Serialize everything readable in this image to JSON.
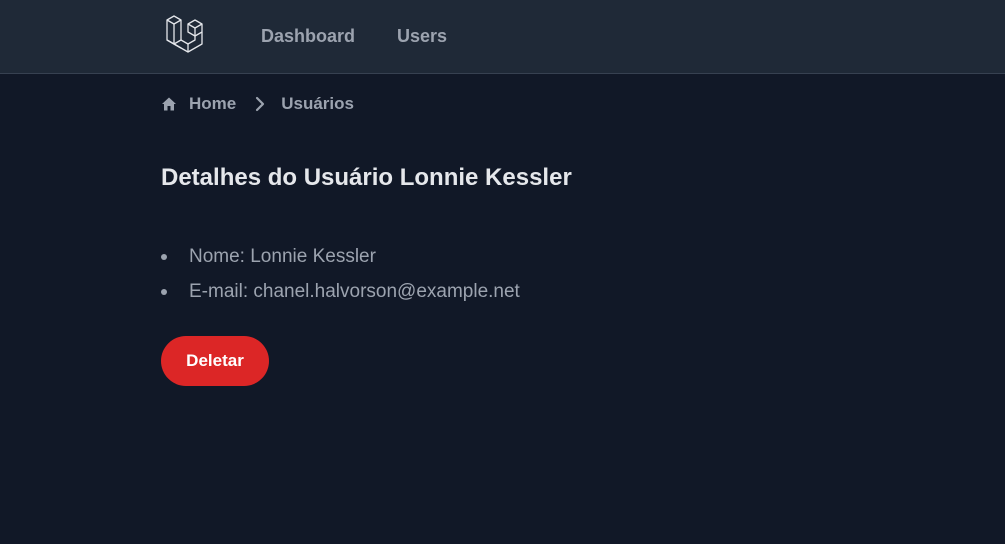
{
  "navbar": {
    "logo_icon": "laravel-logo-icon",
    "links": [
      {
        "label": "Dashboard"
      },
      {
        "label": "Users"
      }
    ]
  },
  "breadcrumb": {
    "home_icon": "home-icon",
    "items": [
      {
        "label": "Home"
      },
      {
        "label": "Usuários"
      }
    ],
    "separator_icon": "chevron-right-icon"
  },
  "main": {
    "title": "Detalhes do Usuário Lonnie Kessler",
    "details": [
      {
        "text": "Nome: Lonnie Kessler"
      },
      {
        "text": "E-mail: chanel.halvorson@example.net"
      }
    ],
    "delete_button_label": "Deletar"
  },
  "colors": {
    "background": "#111827",
    "navbar": "#1f2937",
    "text_muted": "#9ca3af",
    "text_heading": "#e5e7eb",
    "danger": "#dc2626"
  }
}
